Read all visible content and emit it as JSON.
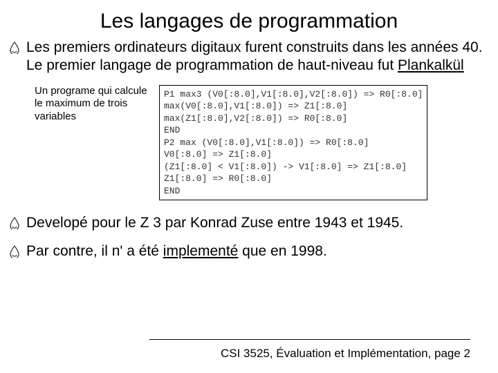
{
  "title": "Les langages de programmation",
  "bullets": [
    {
      "pre": "Les premiers ordinateurs digitaux furent construits dans les années 40. Le premier langage  de programmation de haut-niveau fut ",
      "link": "Plankalkül",
      "post": ""
    },
    {
      "pre": "Developé pour le Z 3 par Konrad Zuse entre 1943 et 1945.",
      "link": "",
      "post": ""
    },
    {
      "pre": "Par contre, il n' a été ",
      "link": "implementé",
      "post": " que en 1998."
    }
  ],
  "example_caption": "Un programe qui calcule le maximum de trois variables",
  "code": "P1 max3 (V0[:8.0],V1[:8.0],V2[:8.0]) => R0[:8.0]\nmax(V0[:8.0],V1[:8.0]) => Z1[:8.0]\nmax(Z1[:8.0],V2[:8.0]) => R0[:8.0]\nEND\nP2 max (V0[:8.0],V1[:8.0]) => R0[:8.0]\nV0[:8.0] => Z1[:8.0]\n(Z1[:8.0] < V1[:8.0]) -> V1[:8.0] => Z1[:8.0]\nZ1[:8.0] => R0[:8.0]\nEND",
  "footer": "CSI 3525, Évaluation et Implémentation, page 2"
}
